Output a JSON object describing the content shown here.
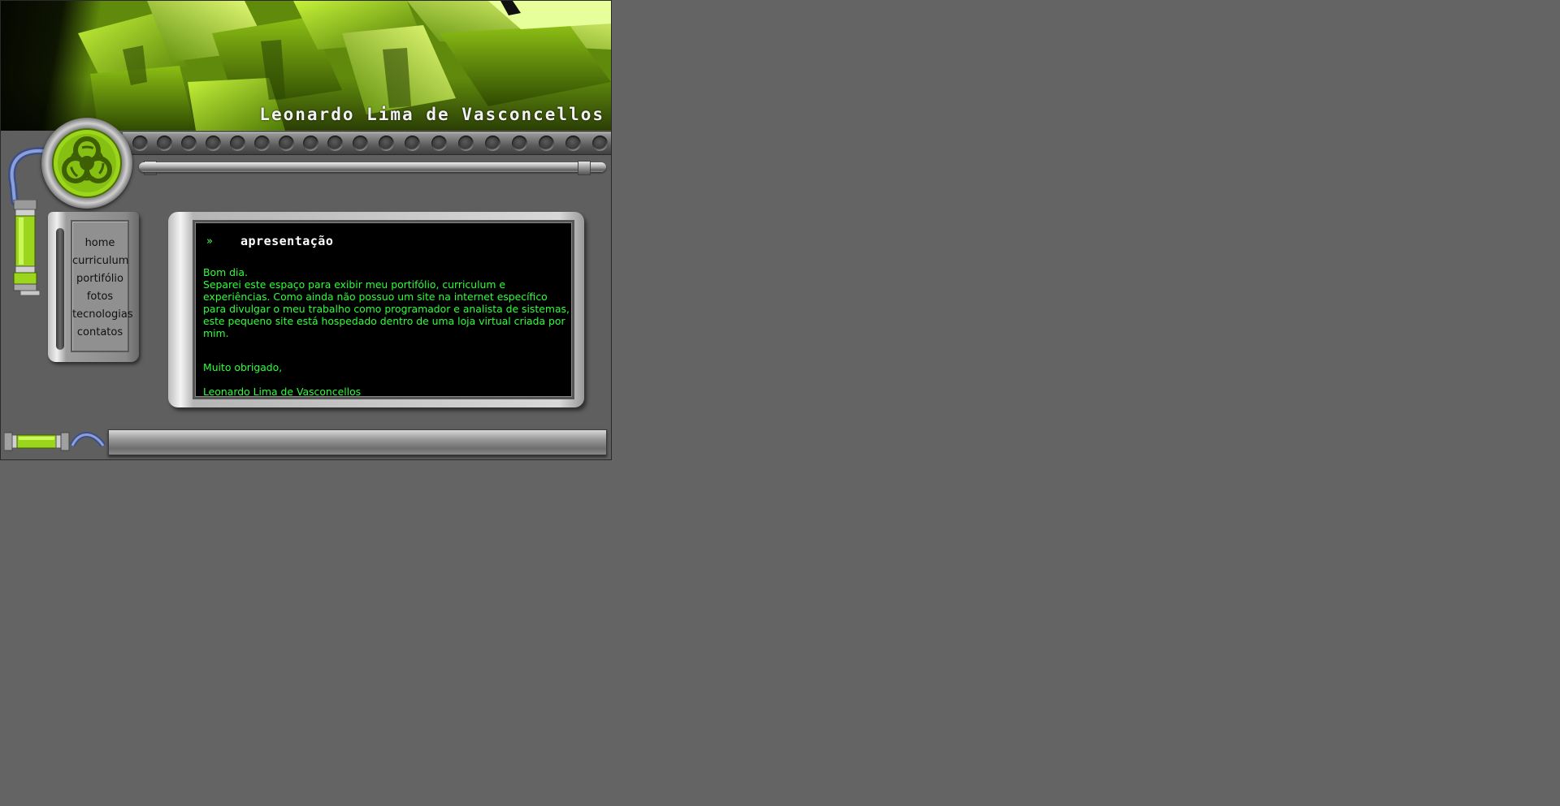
{
  "header": {
    "site_title": "Leonardo Lima de Vasconcellos"
  },
  "nav": {
    "items": [
      {
        "label": "home"
      },
      {
        "label": "curriculum"
      },
      {
        "label": "portifólio"
      },
      {
        "label": "fotos"
      },
      {
        "label": "tecnologias"
      },
      {
        "label": "contatos"
      }
    ]
  },
  "content": {
    "arrow": "»",
    "section_title": "apresentação",
    "greeting": "Bom dia.",
    "paragraph": "Separei este espaço para exibir meu portifólio, curriculum e experiências. Como ainda não possuo um site na internet específico para divulgar o meu trabalho como programador e analista de sistemas, este pequeno site está hospedado dentro de uma loja virtual criada por mim.",
    "thanks": "Muito obrigado,",
    "signature": "Leonardo Lima de Vasconcellos"
  },
  "colors": {
    "page_background": "#646464",
    "content_text": "#2dff3a",
    "accent_green": "#9bd61c"
  },
  "icons": {
    "badge": "biohazard-icon",
    "section": "double-chevron-right-icon"
  }
}
